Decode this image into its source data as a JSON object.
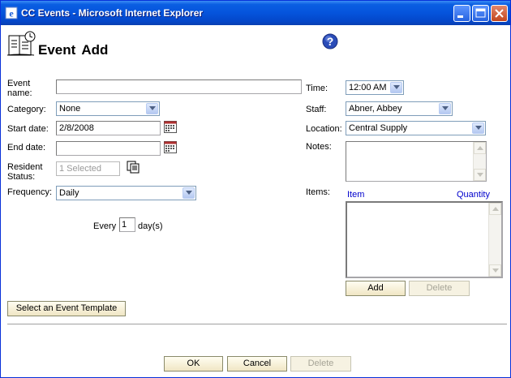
{
  "window": {
    "title": "CC Events - Microsoft Internet Explorer"
  },
  "page": {
    "heading": "Event  Add"
  },
  "left": {
    "event_name_label": "Event name:",
    "event_name_value": "",
    "category_label": "Category:",
    "category_value": "None",
    "start_date_label": "Start date:",
    "start_date_value": "2/8/2008",
    "end_date_label": "End date:",
    "end_date_value": "",
    "resident_status_label": "Resident Status:",
    "resident_status_value": "1 Selected",
    "frequency_label": "Frequency:",
    "frequency_value": "Daily",
    "every_prefix": "Every",
    "every_value": "1",
    "every_suffix": "day(s)",
    "template_button": "Select an Event Template"
  },
  "right": {
    "time_label": "Time:",
    "time_value": "12:00 AM",
    "staff_label": "Staff:",
    "staff_value": "Abner, Abbey",
    "location_label": "Location:",
    "location_value": "Central Supply",
    "notes_label": "Notes:",
    "notes_value": "",
    "items_label": "Items:",
    "items_col_item": "Item",
    "items_col_quantity": "Quantity",
    "items": [],
    "add_button": "Add",
    "delete_button": "Delete"
  },
  "footer": {
    "ok_button": "OK",
    "cancel_button": "Cancel",
    "delete_button": "Delete"
  },
  "colors": {
    "titlebar": "#0554dc",
    "link_blue": "#0000cc",
    "help_icon": "#2a4cb8"
  }
}
